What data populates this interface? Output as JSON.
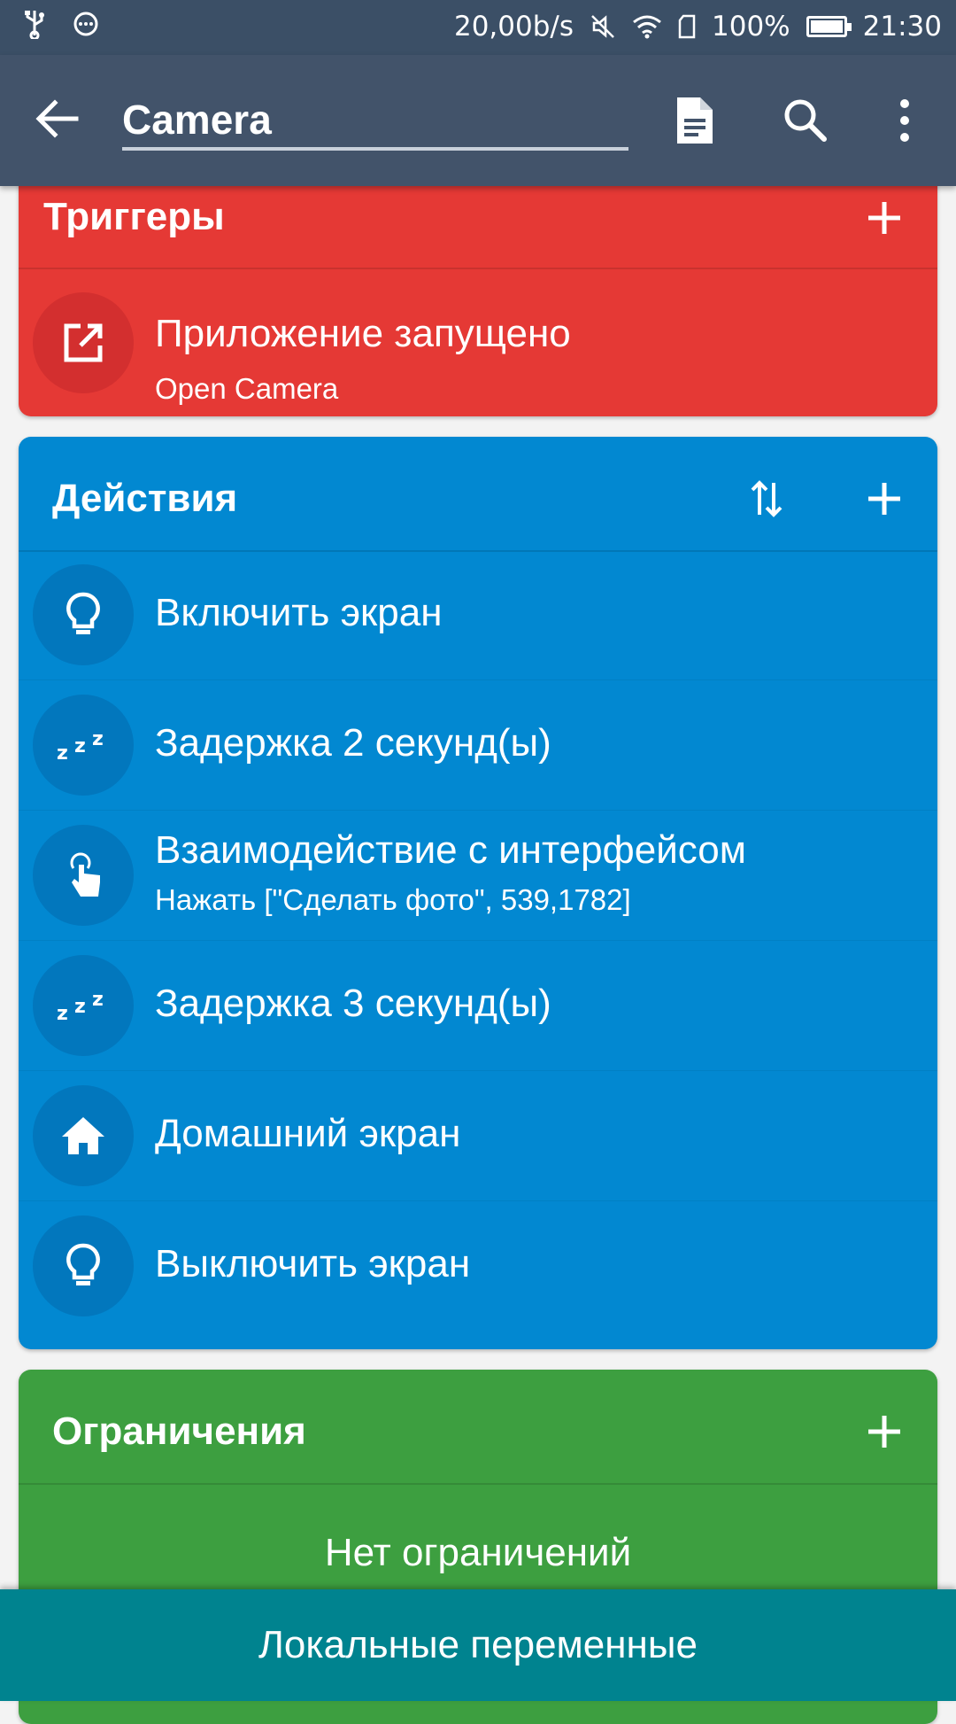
{
  "status_bar": {
    "speed": "20,00b/s",
    "battery": "100%",
    "time": "21:30"
  },
  "appbar": {
    "title": "Camera"
  },
  "triggers": {
    "title": "Триггеры",
    "items": [
      {
        "title": "Приложение запущено",
        "subtitle": "Open Camera",
        "icon": "open-external-icon"
      }
    ]
  },
  "actions": {
    "title": "Действия",
    "items": [
      {
        "title": "Включить экран",
        "subtitle": "",
        "icon": "lightbulb-icon"
      },
      {
        "title": "Задержка 2 секунд(ы)",
        "subtitle": "",
        "icon": "sleep-zzz-icon"
      },
      {
        "title": "Взаимодействие с интерфейсом",
        "subtitle": "Нажать [\"Сделать фото\", 539,1782]",
        "icon": "touch-hand-icon"
      },
      {
        "title": "Задержка 3 секунд(ы)",
        "subtitle": "",
        "icon": "sleep-zzz-icon"
      },
      {
        "title": "Домашний экран",
        "subtitle": "",
        "icon": "home-icon"
      },
      {
        "title": "Выключить экран",
        "subtitle": "",
        "icon": "lightbulb-icon"
      }
    ]
  },
  "constraints": {
    "title": "Ограничения",
    "empty_text": "Нет ограничений"
  },
  "bottom_bar": {
    "label": "Локальные переменные"
  },
  "colors": {
    "status_bar": "#3b4f66",
    "app_bar": "#42536a",
    "triggers": "#e53935",
    "actions": "#0288d1",
    "constraints": "#3d9f40",
    "bottom_bar": "#00838f"
  }
}
